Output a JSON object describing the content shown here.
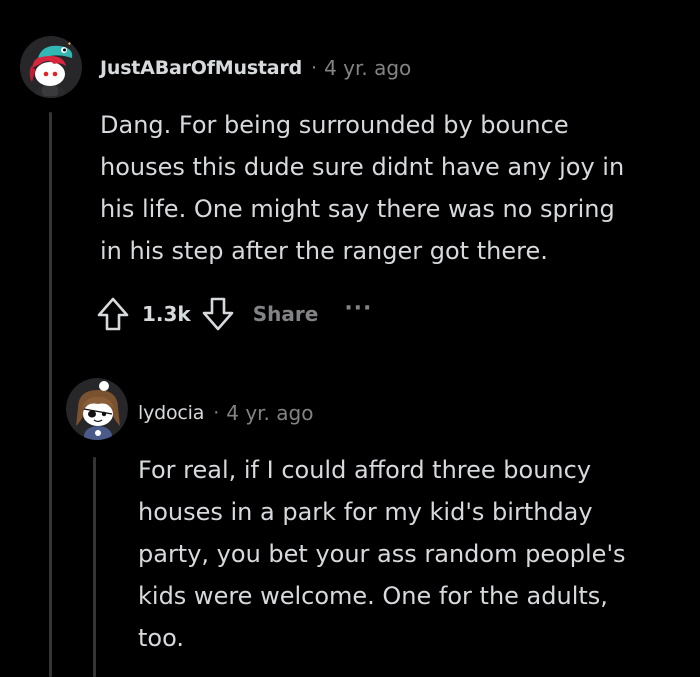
{
  "colors": {
    "background": "#000000",
    "text": "#d7dadc",
    "muted": "#818384",
    "thread_line": "#343536"
  },
  "comment": {
    "avatar_icon": "snoo-avatar-red-hair-teal-hat",
    "username": "JustABarOfMustard",
    "separator": "·",
    "timestamp": "4 yr. ago",
    "body_lines": [
      "Dang. For being surrounded by bounce",
      "houses this dude sure didnt have any joy in",
      "his life. One might say there was no spring",
      "in his step after the ranger got there."
    ],
    "actions": {
      "upvote_icon": "arrow-up-outline-icon",
      "score": "1.3k",
      "downvote_icon": "arrow-down-outline-icon",
      "share_label": "Share",
      "more_label": "···"
    }
  },
  "reply": {
    "avatar_icon": "snoo-avatar-brown-hair-eyepatch",
    "username": "lydocia",
    "separator": "·",
    "timestamp": "4 yr. ago",
    "body_lines": [
      "For real, if I could afford three bouncy",
      "houses in a park for my kid's birthday",
      "party, you bet your ass random people's",
      "kids were welcome. One for the adults,",
      "too."
    ]
  }
}
